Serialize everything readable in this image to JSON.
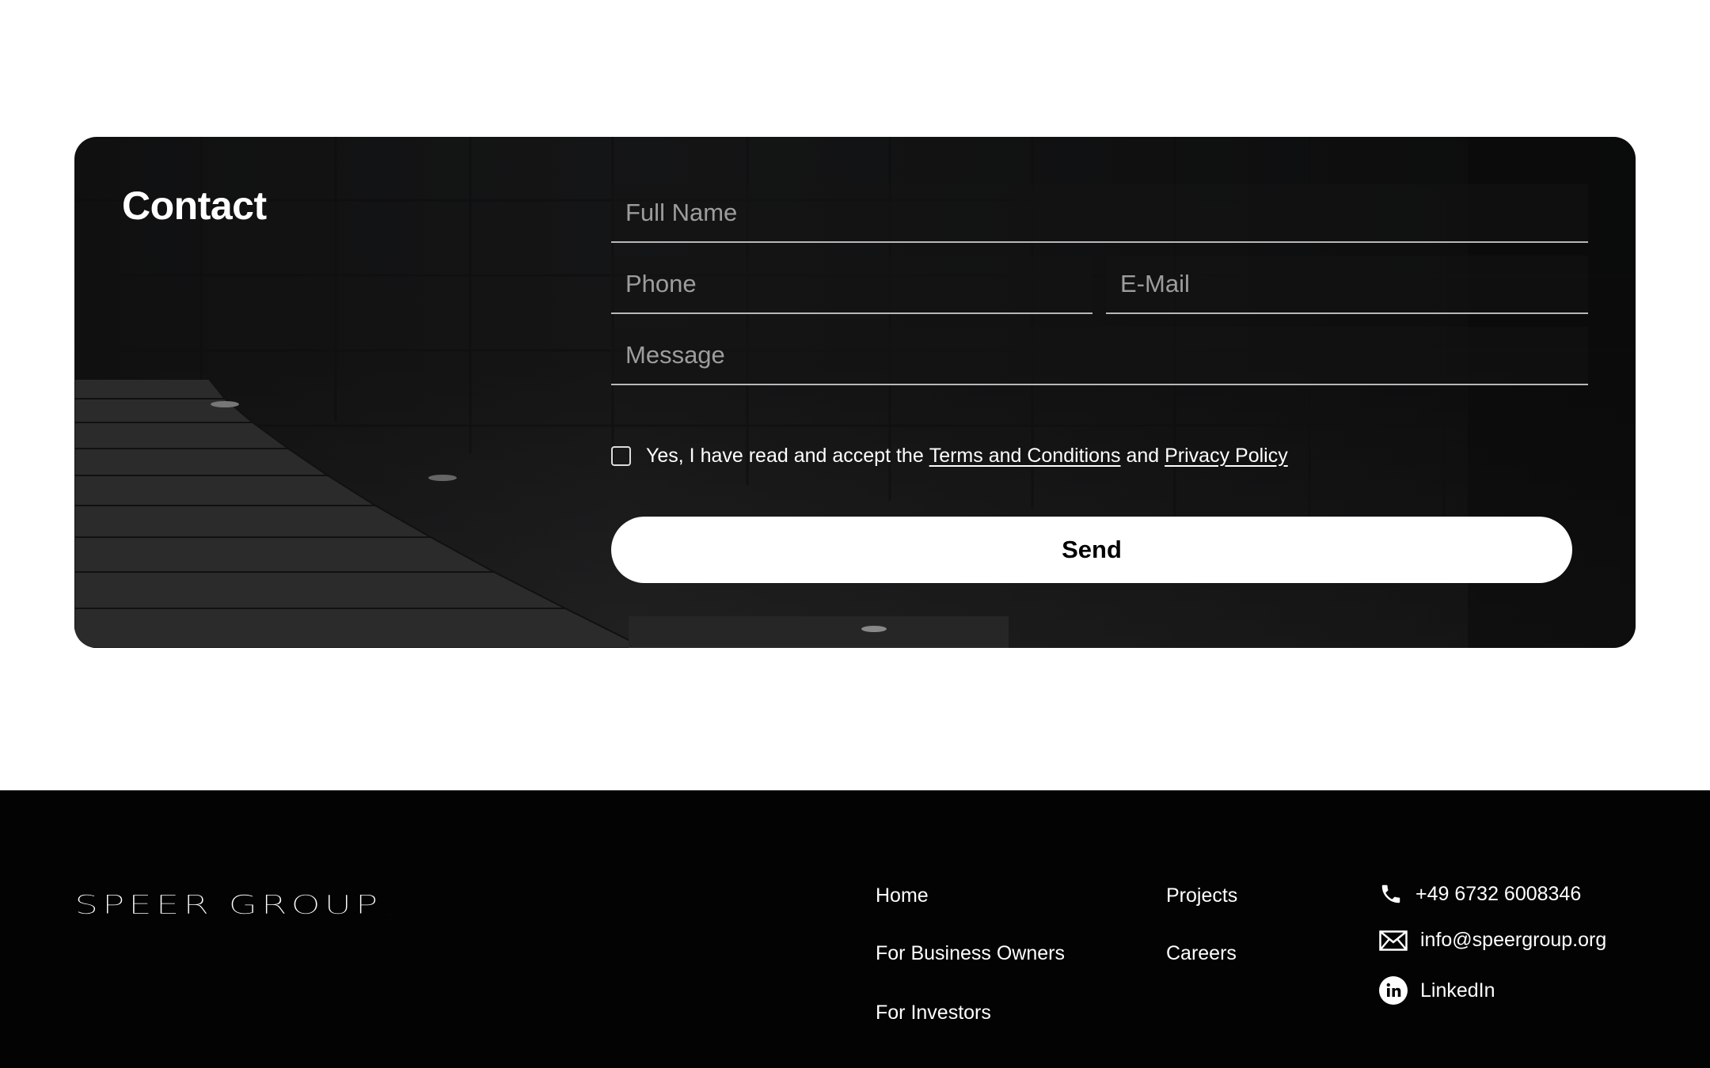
{
  "contact": {
    "title": "Contact",
    "fields": {
      "full_name_placeholder": "Full Name",
      "phone_placeholder": "Phone",
      "email_placeholder": "E-Mail",
      "message_placeholder": "Message"
    },
    "consent": {
      "prefix": "Yes, I have read and accept the",
      "terms_link": "Terms and Conditions",
      "connector": "and",
      "privacy_link": "Privacy Policy",
      "checked": false
    },
    "send_label": "Send"
  },
  "footer": {
    "logo_text": "SPEER GROUP",
    "logo_mark": "®",
    "nav": {
      "home": "Home",
      "business_owners": "For Business Owners",
      "investors": "For Investors",
      "projects": "Projects",
      "careers": "Careers"
    },
    "contact": {
      "phone": "+49 6732 6008346",
      "email": "info@speergroup.org",
      "linkedin": "LinkedIn"
    },
    "icons": {
      "phone": "phone-icon",
      "email": "envelope-icon",
      "linkedin": "linkedin-icon"
    }
  },
  "colors": {
    "background": "#ffffff",
    "card": "#1a1a1b",
    "footer": "#030303",
    "button": "#ffffff",
    "text_light": "#ffffff"
  }
}
